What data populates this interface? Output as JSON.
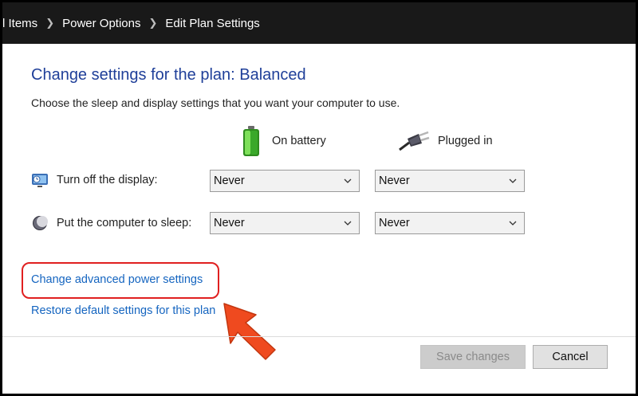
{
  "breadcrumb": {
    "items": [
      "l Items",
      "Power Options",
      "Edit Plan Settings"
    ]
  },
  "page": {
    "title": "Change settings for the plan: Balanced",
    "subtitle": "Choose the sleep and display settings that you want your computer to use."
  },
  "columns": {
    "battery": "On battery",
    "plugged": "Plugged in"
  },
  "rows": {
    "display": {
      "label": "Turn off the display:",
      "battery_value": "Never",
      "plugged_value": "Never"
    },
    "sleep": {
      "label": "Put the computer to sleep:",
      "battery_value": "Never",
      "plugged_value": "Never"
    }
  },
  "links": {
    "advanced": "Change advanced power settings",
    "restore": "Restore default settings for this plan"
  },
  "buttons": {
    "save": "Save changes",
    "cancel": "Cancel"
  },
  "icons": {
    "battery": "battery-icon",
    "plug": "plug-icon",
    "display": "display-icon",
    "sleep": "moon-icon",
    "chevron": "chevron-down-icon",
    "arrow": "red-arrow-icon"
  },
  "colors": {
    "title": "#1f3f99",
    "link": "#1565c0",
    "highlight": "#e02020",
    "arrow": "#ef4a1f"
  }
}
